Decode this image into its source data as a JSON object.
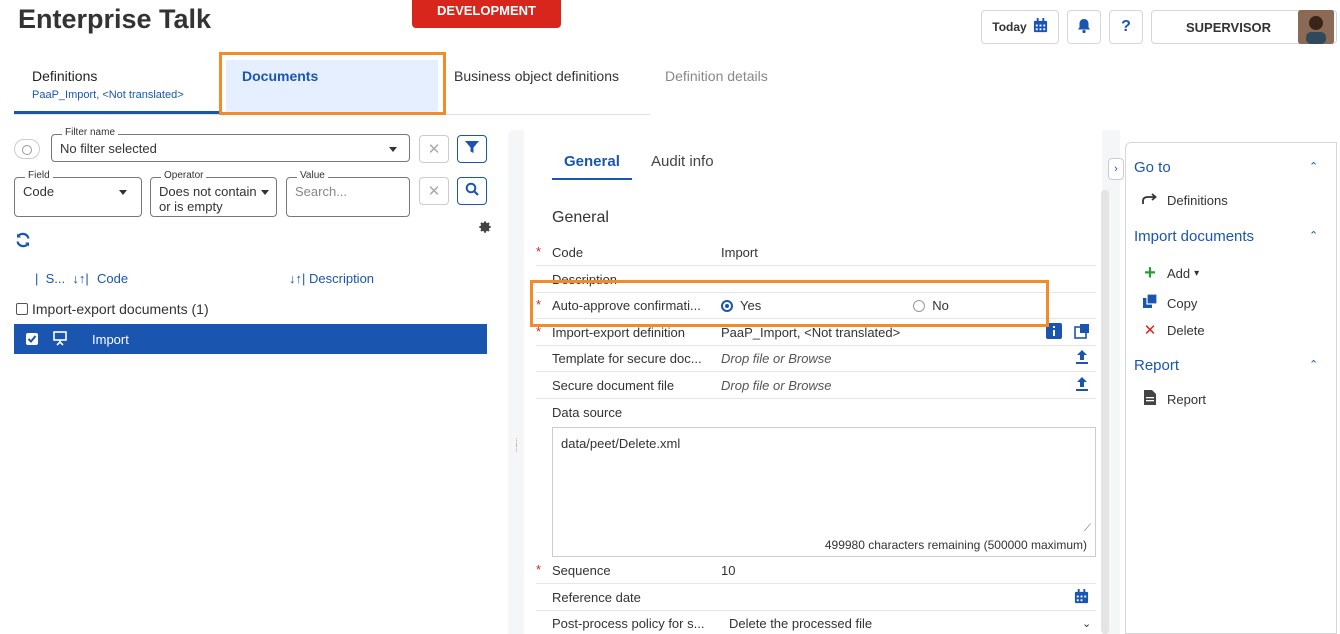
{
  "header": {
    "app_title": "Enterprise Talk",
    "environment_badge": "DEVELOPMENT",
    "today_label": "Today",
    "help_label": "?",
    "user_label": "SUPERVISOR"
  },
  "tabs": [
    {
      "label": "Definitions",
      "sub": "PaaP_Import, <Not translated>"
    },
    {
      "label": "Documents"
    },
    {
      "label": "Business object definitions"
    },
    {
      "label": "Definition details"
    }
  ],
  "filter": {
    "name_label": "Filter name",
    "name_value": "No filter selected",
    "field_label": "Field",
    "field_value": "Code",
    "operator_label": "Operator",
    "operator_value_line1": "Does not contain",
    "operator_value_line2": "or is empty",
    "value_label": "Value",
    "value_placeholder": "Search..."
  },
  "list": {
    "col_status": "S...",
    "col_code": "Code",
    "col_description": "Description",
    "group_label": "Import-export documents (1)",
    "rows": [
      {
        "code": "Import"
      }
    ]
  },
  "detail": {
    "tabs": [
      "General",
      "Audit info"
    ],
    "section_title": "General",
    "fields": {
      "code_label": "Code",
      "code_value": "Import",
      "description_label": "Description",
      "auto_approve_label": "Auto-approve confirmati...",
      "yes_label": "Yes",
      "no_label": "No",
      "ie_def_label": "Import-export definition",
      "ie_def_value": "PaaP_Import, <Not translated>",
      "template_label": "Template for secure doc...",
      "template_value": "Drop file or Browse",
      "secure_file_label": "Secure document file",
      "secure_file_value": "Drop file or Browse",
      "data_source_label": "Data source",
      "data_source_value": "data/peet/Delete.xml",
      "chars_remaining": "499980 characters remaining (500000 maximum)",
      "sequence_label": "Sequence",
      "sequence_value": "10",
      "ref_date_label": "Reference date",
      "post_process_label": "Post-process policy for s...",
      "post_process_value": "Delete the processed file"
    }
  },
  "sidebar": {
    "goto_title": "Go to",
    "goto_definitions": "Definitions",
    "import_title": "Import documents",
    "add_label": "Add",
    "copy_label": "Copy",
    "delete_label": "Delete",
    "report_title": "Report",
    "report_label": "Report"
  },
  "colors": {
    "accent": "#1a56b0",
    "highlight": "#f38b2b",
    "env_badge": "#d9261c"
  }
}
